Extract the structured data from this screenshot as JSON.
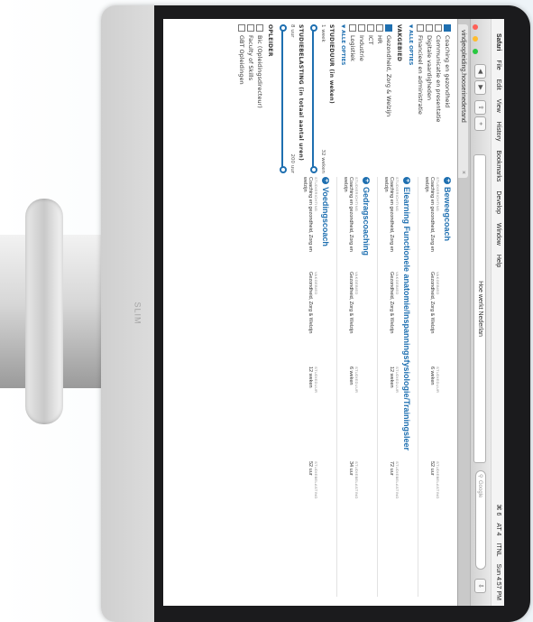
{
  "monitor": {
    "brand": "SLIM"
  },
  "menubar": {
    "app": "Safari",
    "items": [
      "File",
      "Edit",
      "View",
      "History",
      "Bookmarks",
      "Develop",
      "Window",
      "Help"
    ],
    "right": [
      "⌘ 6",
      "AT 4",
      "ITNL",
      "Sun 4:57 PM"
    ]
  },
  "toolbar": {
    "address": "Hoe werkt Nederlan",
    "search_placeholder": "Google"
  },
  "tab": {
    "title": "vindjeopleiding.hooserinedertand"
  },
  "filters": {
    "group1": [
      {
        "label": "Coaching en gezondheid",
        "checked": true
      },
      {
        "label": "Communicatie en presentatie",
        "checked": false
      },
      {
        "label": "Digitale vaardigheden",
        "checked": false
      },
      {
        "label": "Financieel en administratie",
        "checked": false
      }
    ],
    "more1": "ALLE OPTIES",
    "vakgebied_title": "VAKGEBIED",
    "vakgebied": [
      {
        "label": "Gezondheid, Zorg & Welzijn",
        "checked": true
      },
      {
        "label": "HR",
        "checked": false
      },
      {
        "label": "ICT",
        "checked": false
      },
      {
        "label": "Industrie",
        "checked": false
      },
      {
        "label": "Logistiek",
        "checked": false
      }
    ],
    "more2": "ALLE OPTIES",
    "studieduur_title": "STUDIEDUUR (in weken)",
    "studieduur_min": "1 week",
    "studieduur_max": "32 weken",
    "studiebelasting_title": "STUDIEBELASTING (in totaal aantal uren)",
    "studiebelasting_min": "8 uur",
    "studiebelasting_max": "200 uur",
    "opleider_title": "OPLEIDER",
    "opleider": [
      {
        "label": "Bic (Opleidingsdirecteur)",
        "checked": false
      },
      {
        "label": "Faculty of Skills",
        "checked": false
      },
      {
        "label": "GBT Opleidingen",
        "checked": false
      }
    ]
  },
  "results": [
    {
      "title": "Beweegcoach",
      "studierichting": "Coaching en gezondheid, Zorg en welzijn",
      "vakgebied": "Gezondheid, Zorg & Welzijn",
      "studieduur": "6 weken",
      "studiebelasting": "52 uur"
    },
    {
      "title": "Elearning Functionele anatomie/Inspanningsfysiologie/Trainingsleer",
      "studierichting": "Coaching en gezondheid, Zorg en welzijn",
      "vakgebied": "Gezondheid, Zorg & Welzijn",
      "studieduur": "12 weken",
      "studiebelasting": "72 uur"
    },
    {
      "title": "Gedragscoaching",
      "studierichting": "Coaching en gezondheid, Zorg en welzijn",
      "vakgebied": "Gezondheid, Zorg & Welzijn",
      "studieduur": "6 weken",
      "studiebelasting": "34 uur"
    },
    {
      "title": "Voedingscoach",
      "studierichting": "Coaching en gezondheid, Zorg en welzijn",
      "vakgebied": "Gezondheid, Zorg & Welzijn",
      "studieduur": "12 weken",
      "studiebelasting": "52 uur"
    }
  ],
  "result_labels": {
    "studierichting": "STUDIERICHTING",
    "vakgebied": "VAKGEBIED",
    "studieduur": "STUDIEDUUR",
    "studiebelasting": "STUDIEBELASTING"
  },
  "colors": {
    "accent": "#1e6fb0",
    "bezel": "#1b1b1d"
  }
}
